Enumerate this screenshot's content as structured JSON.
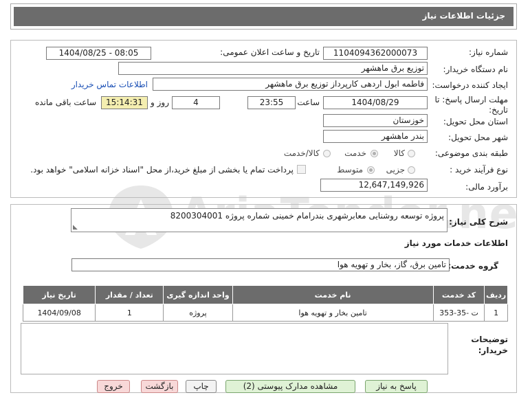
{
  "header": {
    "title": "جزئیات اطلاعات نیاز"
  },
  "watermark": {
    "text": "AriaTender.neT"
  },
  "form": {
    "need_number_label": "شماره نیاز:",
    "need_number": "1104094362000073",
    "announce_label": "تاریخ و ساعت اعلان عمومی:",
    "announce_value": "1404/08/25 - 08:05",
    "buyer_org_label": "نام دستگاه خریدار:",
    "buyer_org": "توزیع برق ماهشهر",
    "creator_label": "ایجاد کننده درخواست:",
    "creator": "فاطمه ابول اردهی کارپرداز توزیع برق ماهشهر",
    "contact_link": "اطلاعات تماس خریدار",
    "deadline_label": "مهلت ارسال پاسخ: تا تاریخ:",
    "deadline_date": "1404/08/29",
    "time_word": "ساعت",
    "deadline_time": "23:55",
    "days": "4",
    "days_word": "روز و",
    "remaining_time": "15:14:31",
    "remaining_word": "ساعت باقی مانده",
    "province_label": "استان محل تحویل:",
    "province": "خوزستان",
    "city_label": "شهر محل تحویل:",
    "city": "بندر ماهشهر",
    "category_label": "طبقه بندی موضوعی:",
    "category_options": [
      "کالا",
      "خدمت",
      "کالا/خدمت"
    ],
    "category_selected": "خدمت",
    "process_label": "نوع فرآیند خرید :",
    "process_options": [
      "جزیی",
      "متوسط"
    ],
    "process_selected": "متوسط",
    "payment_note": "پرداخت تمام یا بخشی از مبلغ خرید،از محل \"اسناد خزانه اسلامی\" خواهد بود.",
    "budget_label": "برآورد مالی:",
    "budget": "12,647,149,926"
  },
  "summary": {
    "label": "شرح کلی نیاز:",
    "text": "پروژه توسعه روشنایی معابرشهری بندرامام خمینی شماره پروژه 8200304001"
  },
  "services": {
    "section_title": "اطلاعات خدمات مورد نیاز",
    "group_label": "گروه خدمت:",
    "group_value": "تامین برق، گاز، بخار و تهویه هوا",
    "table_headers": [
      "ردیف",
      "کد خدمت",
      "نام خدمت",
      "واحد اندازه گیری",
      "تعداد / مقدار",
      "تاریخ نیاز"
    ],
    "rows": [
      [
        "1",
        "ت -35-353",
        "تامین بخار و تهویه هوا",
        "پروژه",
        "1",
        "1404/09/08"
      ]
    ]
  },
  "buyer_notes": {
    "label": "توضیحات خریدار:",
    "value": ""
  },
  "buttons": {
    "reply": "پاسخ به نیاز",
    "attachments": "مشاهده مدارک پیوستی (2)",
    "print": "چاپ",
    "back": "بازگشت",
    "exit": "خروج"
  },
  "colors": {
    "header_bg": "#6c6c6c",
    "link": "#1a4fb5",
    "remaining_bg": "#f4eeb0",
    "reply_bg": "#dff2d5",
    "back_bg": "#f8d8d8"
  }
}
